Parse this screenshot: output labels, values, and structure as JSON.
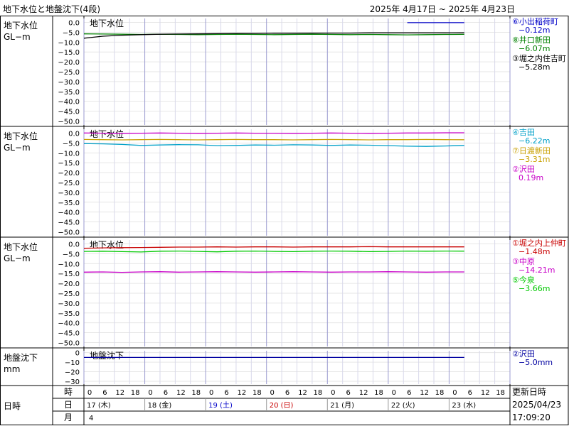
{
  "header": {
    "title": "地下水位と地盤沈下(4段)",
    "range": "2025年 4月17日 ~ 2025年 4月23日"
  },
  "chart_data": [
    {
      "type": "line",
      "title": "地下水位",
      "ylabel": "地下水位\nGL−m",
      "yticks": [
        "0.0",
        "−5.0",
        "−10.0",
        "−15.0",
        "−20.0",
        "−25.0",
        "−30.0",
        "−35.0",
        "−40.0",
        "−45.0",
        "−50.0"
      ],
      "ylim": [
        -52,
        2
      ],
      "series": [
        {
          "name": "⑥小出稲荷町",
          "value_text": "−0.12m",
          "color": "#0000c8",
          "values": [
            -0.12,
            null,
            null,
            -0.12,
            null,
            null,
            null,
            null,
            null,
            null,
            null,
            -0.12,
            null,
            null,
            null,
            null,
            null,
            -0.12,
            -0.12,
            -0.12,
            -0.12
          ]
        },
        {
          "name": "⑧井口新田",
          "value_text": "−6.07m",
          "color": "#008000",
          "values": [
            -5.8,
            -5.9,
            -6.0,
            -6.1,
            -6.0,
            -6.1,
            -6.2,
            -6.1,
            -6.0,
            -6.1,
            -6.2,
            -6.1,
            -6.0,
            -6.1,
            -6.2,
            -6.1,
            -6.2,
            -6.3,
            -6.2,
            -6.1,
            -6.07
          ]
        },
        {
          "name": "③堀之内住吉町",
          "value_text": "−5.28m",
          "color": "#000000",
          "values": [
            -8.0,
            -7.0,
            -6.5,
            -6.2,
            -6.0,
            -5.9,
            -5.8,
            -5.7,
            -5.6,
            -5.6,
            -5.5,
            -5.5,
            -5.4,
            -5.4,
            -5.4,
            -5.3,
            -5.3,
            -5.3,
            -5.3,
            -5.3,
            -5.28
          ]
        }
      ]
    },
    {
      "type": "line",
      "title": "地下水位",
      "ylabel": "地下水位\nGL−m",
      "yticks": [
        "0.0",
        "−5.0",
        "−10.0",
        "−15.0",
        "−20.0",
        "−25.0",
        "−30.0",
        "−35.0",
        "−40.0",
        "−45.0",
        "−50.0"
      ],
      "ylim": [
        -52,
        2
      ],
      "series": [
        {
          "name": "④吉田",
          "value_text": "−6.22m",
          "color": "#00a0c8",
          "values": [
            -5.3,
            -5.4,
            -5.7,
            -6.2,
            -6.0,
            -5.8,
            -5.9,
            -6.3,
            -6.2,
            -6.0,
            -6.1,
            -5.9,
            -6.0,
            -6.2,
            -6.0,
            -6.1,
            -6.3,
            -6.6,
            -6.7,
            -6.5,
            -6.22
          ]
        },
        {
          "name": "⑦日渡新田",
          "value_text": "−3.31m",
          "color": "#c8a000",
          "values": [
            -3.2,
            -3.3,
            -3.4,
            -3.3,
            -3.2,
            -3.3,
            -3.4,
            -3.3,
            -3.2,
            -3.3,
            -3.3,
            -3.4,
            -3.3,
            -3.2,
            -3.3,
            -3.4,
            -3.3,
            -3.3,
            -3.2,
            -3.3,
            -3.31
          ]
        },
        {
          "name": "②沢田",
          "value_text": "0.19m",
          "color": "#c800c8",
          "values": [
            0.1,
            0.0,
            -0.1,
            0.0,
            0.1,
            0.0,
            -0.1,
            0.0,
            0.1,
            0.0,
            0.0,
            -0.1,
            0.0,
            0.1,
            0.0,
            -0.1,
            0.0,
            0.1,
            0.1,
            0.2,
            0.19
          ]
        }
      ]
    },
    {
      "type": "line",
      "title": "地下水位",
      "ylabel": "地下水位\nGL−m",
      "yticks": [
        "0.0",
        "−5.0",
        "−10.0",
        "−15.0",
        "−20.0",
        "−25.0",
        "−30.0",
        "−35.0",
        "−40.0",
        "−45.0",
        "−50.0"
      ],
      "ylim": [
        -52,
        2
      ],
      "series": [
        {
          "name": "①堀之内上仲町",
          "value_text": "−1.48m",
          "color": "#c80000",
          "values": [
            -2.2,
            -2.0,
            -1.9,
            -1.8,
            -1.7,
            -1.6,
            -1.6,
            -1.5,
            -1.6,
            -1.5,
            -1.5,
            -1.6,
            -1.5,
            -1.5,
            -1.5,
            -1.4,
            -1.5,
            -1.5,
            -1.5,
            -1.5,
            -1.48
          ]
        },
        {
          "name": "③中原",
          "value_text": "−14.21m",
          "color": "#c800c8",
          "values": [
            -14.3,
            -14.2,
            -14.4,
            -14.2,
            -14.1,
            -14.3,
            -14.2,
            -14.1,
            -14.2,
            -14.3,
            -14.2,
            -14.1,
            -14.2,
            -14.3,
            -14.2,
            -14.2,
            -14.1,
            -14.2,
            -14.3,
            -14.2,
            -14.21
          ]
        },
        {
          "name": "⑤今泉",
          "value_text": "−3.66m",
          "color": "#00c800",
          "values": [
            -3.8,
            -3.7,
            -3.9,
            -4.1,
            -3.7,
            -3.6,
            -3.8,
            -4.0,
            -3.7,
            -3.6,
            -3.8,
            -3.9,
            -3.7,
            -3.6,
            -3.7,
            -3.9,
            -3.8,
            -3.6,
            -3.7,
            -3.6,
            -3.66
          ]
        }
      ]
    },
    {
      "type": "line",
      "title": "地盤沈下",
      "ylabel": "地盤沈下\nmm",
      "yticks": [
        "0",
        "−10",
        "−20",
        "−30"
      ],
      "ylim": [
        -33,
        2
      ],
      "series": [
        {
          "name": "②沢田",
          "value_text": "−5.0mm",
          "color": "#0000a0",
          "values": [
            -5.0,
            -5.0,
            -5.0,
            -5.0,
            -5.0,
            -5.0,
            -5.0,
            -5.0,
            -5.0,
            -5.0,
            -5.0,
            -5.0,
            -5.0,
            -5.0,
            -5.0,
            -5.0,
            -5.0,
            -5.0,
            -5.0,
            -5.0,
            -5.0
          ]
        }
      ]
    }
  ],
  "time_axis": {
    "hour_row_label": "時",
    "day_row_label": "日",
    "month_row_label": "月",
    "left_label": "日時",
    "hours": [
      "0",
      "6",
      "12",
      "18",
      "0",
      "6",
      "12",
      "18",
      "0",
      "6",
      "12",
      "18",
      "0",
      "6",
      "12",
      "18",
      "0",
      "6",
      "12",
      "18",
      "0",
      "6",
      "12",
      "18",
      "0",
      "6",
      "12",
      "18"
    ],
    "days": [
      {
        "label": "17 (木)",
        "color": "#000000"
      },
      {
        "label": "18 (金)",
        "color": "#000000"
      },
      {
        "label": "19 (土)",
        "color": "#0000c8"
      },
      {
        "label": "20 (日)",
        "color": "#c80000"
      },
      {
        "label": "21 (月)",
        "color": "#000000"
      },
      {
        "label": "22 (火)",
        "color": "#000000"
      },
      {
        "label": "23 (水)",
        "color": "#000000"
      }
    ],
    "month": "4"
  },
  "update_info": {
    "label": "更新日時",
    "date": "2025/04/23",
    "time": "17:09:20"
  }
}
